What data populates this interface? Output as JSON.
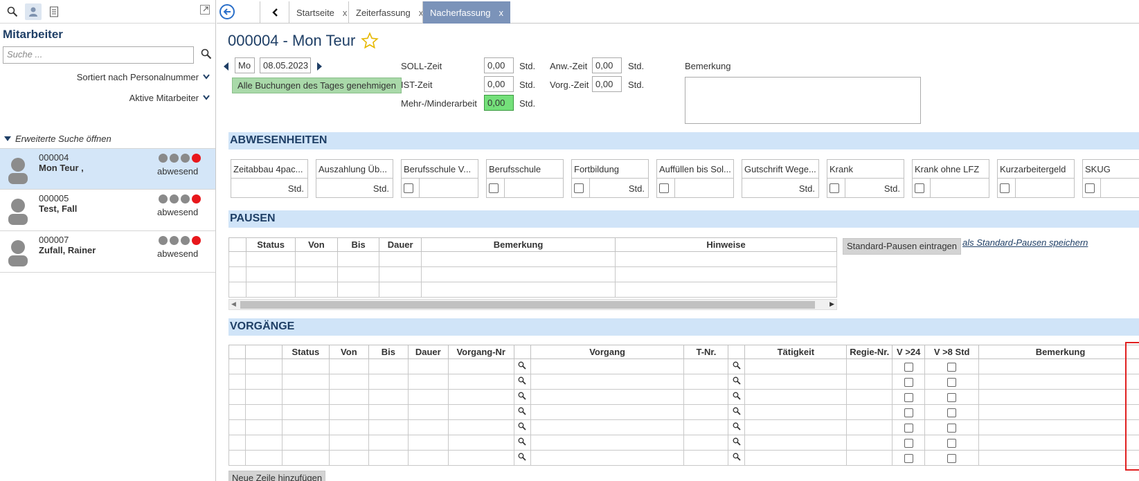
{
  "sidebar": {
    "title": "Mitarbeiter",
    "search_placeholder": "Suche ...",
    "sort_label": "Sortiert nach Personalnummer",
    "filter_label": "Aktive Mitarbeiter",
    "extended_search": "Erweiterte Suche öffnen",
    "employees": [
      {
        "nr": "000004",
        "name": "Mon Teur ,",
        "status": "abwesend",
        "selected": true
      },
      {
        "nr": "000005",
        "name": "Test, Fall",
        "status": "abwesend",
        "selected": false
      },
      {
        "nr": "000007",
        "name": "Zufall, Rainer",
        "status": "abwesend",
        "selected": false
      }
    ]
  },
  "tabs": [
    {
      "label": "Startseite",
      "close": "x"
    },
    {
      "label": "Zeiterfassung",
      "close": "x"
    },
    {
      "label": "Nacherfassung",
      "close": "x",
      "active": true
    }
  ],
  "page_title": "000004 - Mon Teur",
  "day": {
    "weekday": "Mo",
    "date": "08.05.2023",
    "approve_button": "Alle Buchungen des Tages genehmigen"
  },
  "times": {
    "soll_label": "SOLL-Zeit",
    "soll_value": "0,00",
    "ist_label": "IST-Zeit",
    "ist_value": "0,00",
    "mehr_label": "Mehr-/Minderarbeit",
    "mehr_value": "0,00",
    "anw_label": "Anw.-Zeit",
    "anw_value": "0,00",
    "vorg_label": "Vorg.-Zeit",
    "vorg_value": "0,00",
    "unit": "Std.",
    "remark_label": "Bemerkung"
  },
  "absences": {
    "title": "ABWESENHEITEN",
    "cards": [
      {
        "label": "Zeitabbau 4pac...",
        "unit": "Std.",
        "checkbox": false
      },
      {
        "label": "Auszahlung Üb...",
        "unit": "Std.",
        "checkbox": false
      },
      {
        "label": "Berufsschule V...",
        "unit": "",
        "checkbox": true
      },
      {
        "label": "Berufsschule",
        "unit": "",
        "checkbox": true
      },
      {
        "label": "Fortbildung",
        "unit": "Std.",
        "checkbox": true
      },
      {
        "label": "Auffüllen bis Sol...",
        "unit": "",
        "checkbox": true
      },
      {
        "label": "Gutschrift Wege...",
        "unit": "Std.",
        "checkbox": false
      },
      {
        "label": "Krank",
        "unit": "Std.",
        "checkbox": true
      },
      {
        "label": "Krank ohne LFZ",
        "unit": "",
        "checkbox": true
      },
      {
        "label": "Kurzarbeitergeld",
        "unit": "",
        "checkbox": true
      },
      {
        "label": "SKUG",
        "unit": "",
        "checkbox": true
      }
    ]
  },
  "pauses": {
    "title": "PAUSEN",
    "columns": [
      "Status",
      "Von",
      "Bis",
      "Dauer",
      "Bemerkung",
      "Hinweise"
    ],
    "std_button": "Standard-Pausen eintragen",
    "save_link": "als Standard-Pausen speichern"
  },
  "vorgaenge": {
    "title": "VORGÄNGE",
    "columns": [
      "Status",
      "Von",
      "Bis",
      "Dauer",
      "Vorgang-Nr",
      "Vorgang",
      "T-Nr.",
      "Tätigkeit",
      "Regie-Nr.",
      "V >24",
      "V >8 Std",
      "Bemerkung"
    ],
    "new_row_button": "Neue Zeile hinzufügen"
  }
}
